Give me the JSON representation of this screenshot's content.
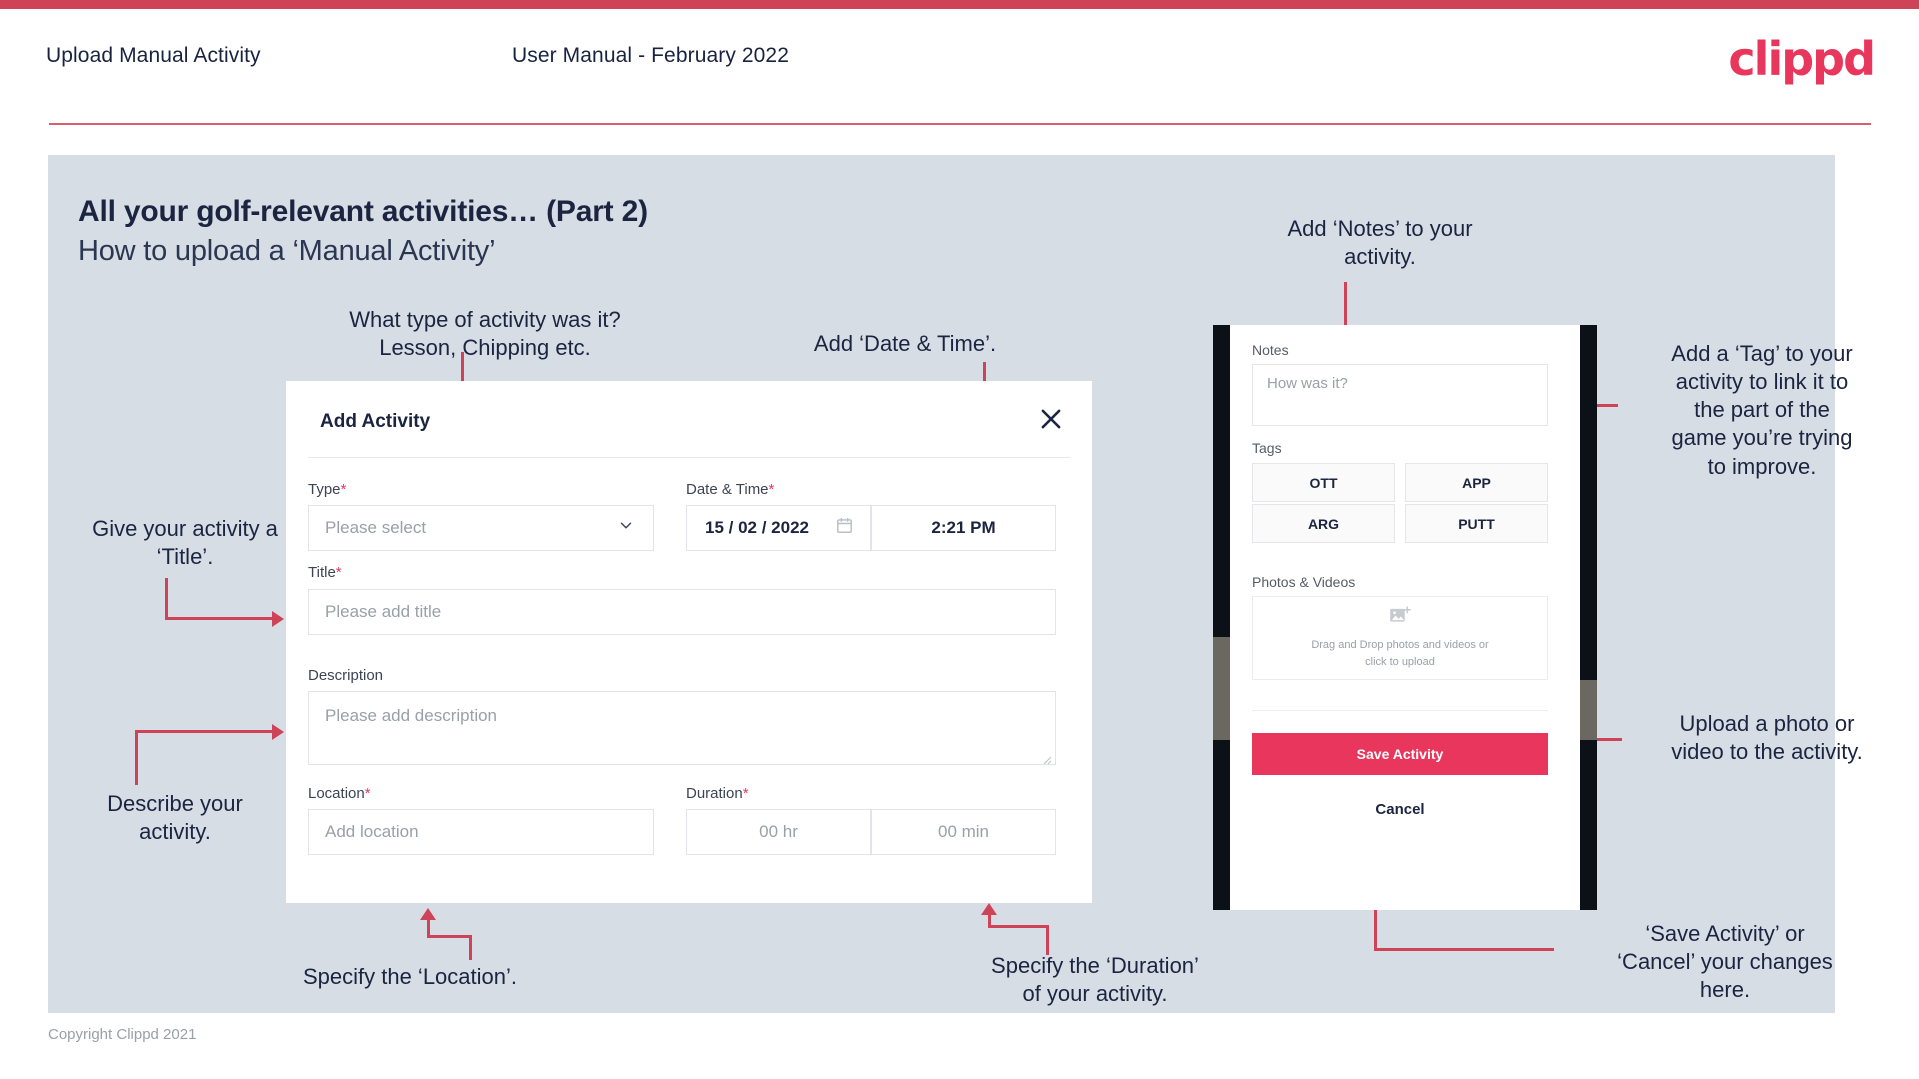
{
  "header": {
    "left_title": "Upload Manual Activity",
    "center_title": "User Manual - February 2022",
    "logo": "clippd"
  },
  "slide": {
    "title": "All your golf-relevant activities… (Part 2)",
    "subtitle": "How to upload a ‘Manual Activity’"
  },
  "annotations": {
    "type": "What type of activity was it?\nLesson, Chipping etc.",
    "datetime": "Add ‘Date & Time’.",
    "title": "Give your activity a\n‘Title’.",
    "description": "Describe your\nactivity.",
    "location": "Specify the ‘Location’.",
    "duration": "Specify the ‘Duration’\nof your activity.",
    "notes": "Add ‘Notes’ to your\nactivity.",
    "tags": "Add a ‘Tag’ to your\nactivity to link it to\nthe part of the\ngame you’re trying\nto improve.",
    "upload": "Upload a photo or\nvideo to the activity.",
    "save_cancel": "‘Save Activity’ or\n‘Cancel’ your changes\nhere."
  },
  "dialog": {
    "title": "Add Activity",
    "close_icon": "close-icon",
    "fields": {
      "type": {
        "label": "Type",
        "required": "*",
        "placeholder": "Please select",
        "icon": "chevron-down-icon"
      },
      "datetime": {
        "label": "Date & Time",
        "required": "*",
        "date_value": "15 / 02 / 2022",
        "time_value": "2:21 PM",
        "icon": "calendar-icon"
      },
      "title": {
        "label": "Title",
        "required": "*",
        "placeholder": "Please add title"
      },
      "description": {
        "label": "Description",
        "required": "",
        "placeholder": "Please add description"
      },
      "location": {
        "label": "Location",
        "required": "*",
        "placeholder": "Add location"
      },
      "duration": {
        "label": "Duration",
        "required": "*",
        "hours_placeholder": "00 hr",
        "minutes_placeholder": "00 min"
      }
    }
  },
  "phone": {
    "notes": {
      "label": "Notes",
      "placeholder": "How was it?"
    },
    "tags": {
      "label": "Tags",
      "items": [
        "OTT",
        "APP",
        "ARG",
        "PUTT"
      ]
    },
    "photos": {
      "label": "Photos & Videos",
      "dropzone_line1": "Drag and Drop photos and videos or",
      "dropzone_line2": "click to upload",
      "icon": "add-image-icon"
    },
    "save_label": "Save Activity",
    "cancel_label": "Cancel"
  },
  "footer": {
    "copyright": "Copyright Clippd 2021"
  },
  "colors": {
    "accent": "#e8365d",
    "bar": "#cf4358",
    "slide_bg": "#d7dde5",
    "text": "#1b2440"
  }
}
